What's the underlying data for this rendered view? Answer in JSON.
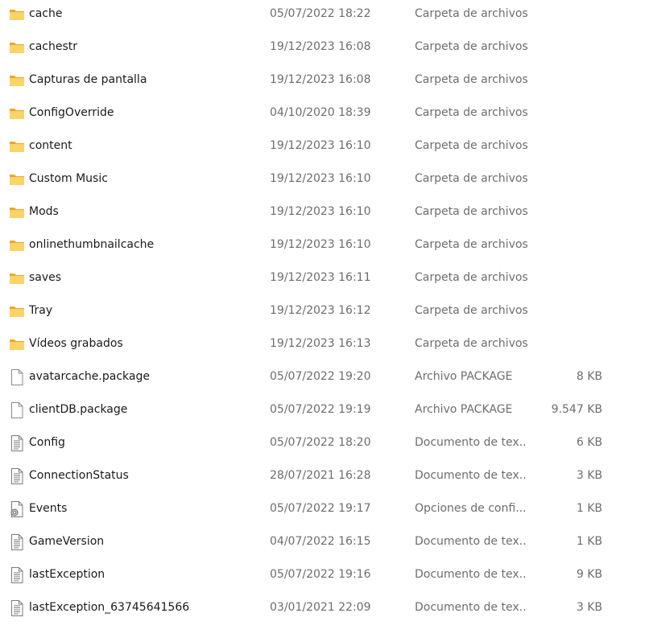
{
  "files": [
    {
      "name": "cache",
      "date": "05/07/2022 18:22",
      "type": "Carpeta de archivos",
      "size": "",
      "icon": "folder-icon"
    },
    {
      "name": "cachestr",
      "date": "19/12/2023 16:08",
      "type": "Carpeta de archivos",
      "size": "",
      "icon": "folder-icon"
    },
    {
      "name": "Capturas de pantalla",
      "date": "19/12/2023 16:08",
      "type": "Carpeta de archivos",
      "size": "",
      "icon": "folder-icon"
    },
    {
      "name": "ConfigOverride",
      "date": "04/10/2020 18:39",
      "type": "Carpeta de archivos",
      "size": "",
      "icon": "folder-icon"
    },
    {
      "name": "content",
      "date": "19/12/2023 16:10",
      "type": "Carpeta de archivos",
      "size": "",
      "icon": "folder-icon"
    },
    {
      "name": "Custom Music",
      "date": "19/12/2023 16:10",
      "type": "Carpeta de archivos",
      "size": "",
      "icon": "folder-icon"
    },
    {
      "name": "Mods",
      "date": "19/12/2023 16:10",
      "type": "Carpeta de archivos",
      "size": "",
      "icon": "folder-icon"
    },
    {
      "name": "onlinethumbnailcache",
      "date": "19/12/2023 16:10",
      "type": "Carpeta de archivos",
      "size": "",
      "icon": "folder-icon"
    },
    {
      "name": "saves",
      "date": "19/12/2023 16:11",
      "type": "Carpeta de archivos",
      "size": "",
      "icon": "folder-icon"
    },
    {
      "name": "Tray",
      "date": "19/12/2023 16:12",
      "type": "Carpeta de archivos",
      "size": "",
      "icon": "folder-icon"
    },
    {
      "name": "Vídeos grabados",
      "date": "19/12/2023 16:13",
      "type": "Carpeta de archivos",
      "size": "",
      "icon": "folder-icon"
    },
    {
      "name": "avatarcache.package",
      "date": "05/07/2022 19:20",
      "type": "Archivo PACKAGE",
      "size": "8 KB",
      "icon": "blank-file-icon"
    },
    {
      "name": "clientDB.package",
      "date": "05/07/2022 19:19",
      "type": "Archivo PACKAGE",
      "size": "9.547 KB",
      "icon": "blank-file-icon"
    },
    {
      "name": "Config",
      "date": "05/07/2022 18:20",
      "type": "Documento de tex...",
      "size": "6 KB",
      "icon": "text-document-icon"
    },
    {
      "name": "ConnectionStatus",
      "date": "28/07/2021 16:28",
      "type": "Documento de tex...",
      "size": "3 KB",
      "icon": "text-document-icon"
    },
    {
      "name": "Events",
      "date": "05/07/2022 19:17",
      "type": "Opciones de confi...",
      "size": "1 KB",
      "icon": "settings-file-icon"
    },
    {
      "name": "GameVersion",
      "date": "04/07/2022 16:15",
      "type": "Documento de tex...",
      "size": "1 KB",
      "icon": "text-document-icon"
    },
    {
      "name": "lastException",
      "date": "05/07/2022 19:16",
      "type": "Documento de tex...",
      "size": "9 KB",
      "icon": "text-document-icon"
    },
    {
      "name": "lastException_63745641566",
      "date": "03/01/2021 22:09",
      "type": "Documento de tex...",
      "size": "3 KB",
      "icon": "text-document-icon"
    }
  ],
  "colors": {
    "folder_back": "#e8a92a",
    "folder_front": "#fcd366",
    "text_primary": "#1a1a1a",
    "text_secondary": "#6d6d6d"
  }
}
